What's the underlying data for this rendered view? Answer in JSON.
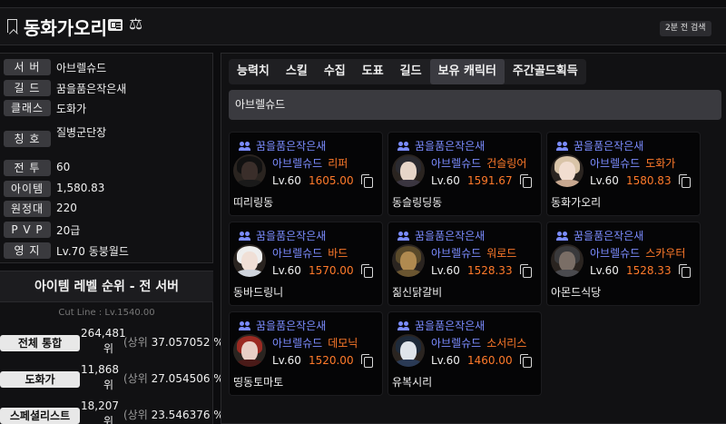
{
  "header": {
    "name": "동화가오리",
    "search_time": "2분 전 검색"
  },
  "info": [
    {
      "label": "서 버",
      "value": "아브렐슈드"
    },
    {
      "label": "길 드",
      "value": "꿈을품은작은새"
    },
    {
      "label": "클래스",
      "value": "도화가"
    },
    {
      "label": "칭 호",
      "value": "질병군단장"
    },
    {
      "label": "전 투",
      "value": "60"
    },
    {
      "label": "아이템",
      "value": "1,580.83"
    },
    {
      "label": "원정대",
      "value": "220"
    },
    {
      "label": "P V P",
      "value": "20급"
    },
    {
      "label": "영 지",
      "value": "Lv.70 동붕월드"
    }
  ],
  "ranking": {
    "title": "아이템 레벨 순위 - 전 서버",
    "cutline": "Cut Line : Lv.1540.00",
    "rows": [
      {
        "label": "전체 통합",
        "num": "264,481",
        "unit": "위",
        "pct_prefix": "(상위",
        "pct": "37.057052 %"
      },
      {
        "label": "도화가",
        "num": "11,868",
        "unit": "위",
        "pct_prefix": "(상위",
        "pct": "27.054506 %)"
      },
      {
        "label": "스페셜리스트",
        "num": "18,207",
        "unit": "위",
        "pct_prefix": "(상위",
        "pct": "23.546376 %)"
      }
    ]
  },
  "tabs": [
    "능력치",
    "스킬",
    "수집",
    "도표",
    "길드",
    "보유 캐릭터",
    "주간골드획득"
  ],
  "server_bar": "아브렐슈드",
  "characters": [
    {
      "guild": "꿈을품은작은새",
      "server": "아브렐슈드",
      "class": "리퍼",
      "level": "Lv.60",
      "ilvl": "1605.00",
      "name": "띠리링동",
      "hair": "#111",
      "face": "#3a2e2a",
      "body": "#1a1a1a"
    },
    {
      "guild": "꿈을품은작은새",
      "server": "아브렐슈드",
      "class": "건슬링어",
      "level": "Lv.60",
      "ilvl": "1591.67",
      "name": "동슬링딩동",
      "hair": "#2a2a30",
      "face": "#e6d5c8",
      "body": "#3a3540"
    },
    {
      "guild": "꿈을품은작은새",
      "server": "아브렐슈드",
      "class": "도화가",
      "level": "Lv.60",
      "ilvl": "1580.83",
      "name": "동화가오리",
      "hair": "#d9c4a8",
      "face": "#f1ddd0",
      "body": "#c8a890"
    },
    {
      "guild": "꿈을품은작은새",
      "server": "아브렐슈드",
      "class": "바드",
      "level": "Lv.60",
      "ilvl": "1570.00",
      "name": "동바드링니",
      "hair": "#eeeeee",
      "face": "#f0dfd6",
      "body": "#cfd4dc"
    },
    {
      "guild": "꿈을품은작은새",
      "server": "아브렐슈드",
      "class": "워로드",
      "level": "Lv.60",
      "ilvl": "1528.33",
      "name": "짊신닭갈비",
      "hair": "#5a4a2a",
      "face": "#b08a50",
      "body": "#6a5530"
    },
    {
      "guild": "꿈을품은작은새",
      "server": "아브렐슈드",
      "class": "스카우터",
      "level": "Lv.60",
      "ilvl": "1528.33",
      "name": "아몬드식당",
      "hair": "#3a3a3c",
      "face": "#7a6e66",
      "body": "#4a4a4e"
    },
    {
      "guild": "꿈을품은작은새",
      "server": "아브렐슈드",
      "class": "데모닉",
      "level": "Lv.60",
      "ilvl": "1520.00",
      "name": "띵동토마토",
      "hair": "#9a2a22",
      "face": "#e8cfc6",
      "body": "#4a1a18"
    },
    {
      "guild": "꿈을품은작은새",
      "server": "아브렐슈드",
      "class": "소서리스",
      "level": "Lv.60",
      "ilvl": "1460.00",
      "name": "유복시리",
      "hair": "#1e2a3a",
      "face": "#dfe4ea",
      "body": "#2a3a55"
    }
  ]
}
